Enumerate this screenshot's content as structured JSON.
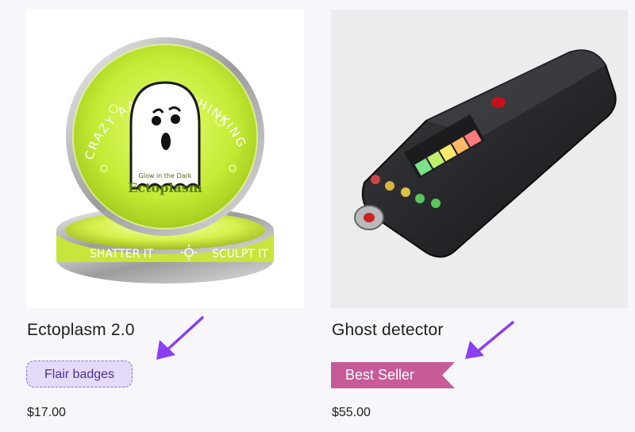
{
  "products": [
    {
      "title": "Ectoplasm 2.0",
      "price": "$17.00",
      "badge": "Flair badges",
      "image_text": {
        "arc_text": "CRAZY AARON'S THINKING PUTTY",
        "glow_label": "Glow in the Dark",
        "name_label": "Ectoplasm",
        "side_left": "SHATTER IT",
        "side_right": "SCULPT IT"
      }
    },
    {
      "title": "Ghost detector",
      "price": "$55.00",
      "badge": "Best Seller"
    }
  ],
  "colors": {
    "page_background": "#f7f7fb",
    "flair_badge_bg": "#e4dafa",
    "flair_badge_border": "#8d71c9",
    "flair_badge_text": "#4f2f8c",
    "ribbon": "#c65b98",
    "arrow": "#8a3ff0"
  },
  "icons": {
    "annotation_arrow": "arrow-icon",
    "ghost": "ghost-icon",
    "sun": "sun-icon"
  }
}
